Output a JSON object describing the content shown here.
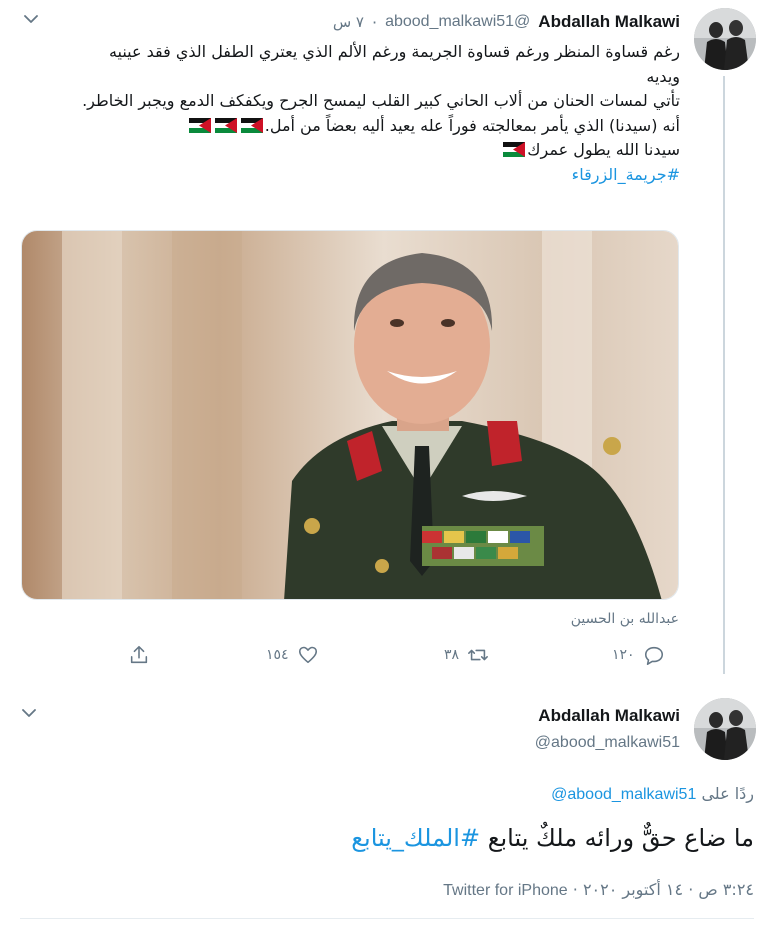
{
  "tweet1": {
    "author_name": "Abdallah Malkawi",
    "author_handle": "@abood_malkawi51",
    "separator": "·",
    "time": "٧ س",
    "lines": [
      "رغم قساوة المنظر ورغم قساوة الجريمة ورغم الألم الذي يعتري الطفل الذي فقد عينيه ويديه",
      "تأتي لمسات الحنان من ألاب الحاني كبير القلب ليمسح الجرح ويكفكف الدمع ويجبر الخاطر.",
      "أنه (سيدنا) الذي يأمر بمعالجته فوراً عله يعيد أليه بعضاً من أمل.",
      "سيدنا الله يطول عمرك"
    ],
    "hashtag": "#جريمة_الزرقاء",
    "photo_caption": "عبدالله بن الحسين",
    "actions": {
      "reply_count": "١٢٠",
      "retweet_count": "٣٨",
      "like_count": "١٥٤"
    }
  },
  "tweet2": {
    "author_name": "Abdallah Malkawi",
    "author_handle": "@abood_malkawi51",
    "reply_prefix": "ردًا على",
    "reply_mention": "@abood_malkawi51",
    "text_main": "ما ضاع حقٌّ ورائه ملكٌ يتابع",
    "text_hashtag": "#الملك_يتابع",
    "time": "٣:٢٤ ص",
    "date": "١٤ أكتوبر ٢٠٢٠",
    "source": "Twitter for iPhone"
  },
  "icons": {
    "chevron": "chevron-down-icon",
    "reply": "reply-icon",
    "retweet": "retweet-icon",
    "like": "heart-icon",
    "share": "share-icon",
    "flag": "jordan-flag-icon"
  },
  "colors": {
    "link": "#1b95e0",
    "secondary_text": "#657786",
    "primary_text": "#14171a",
    "thread_line": "#ccd6dd"
  }
}
